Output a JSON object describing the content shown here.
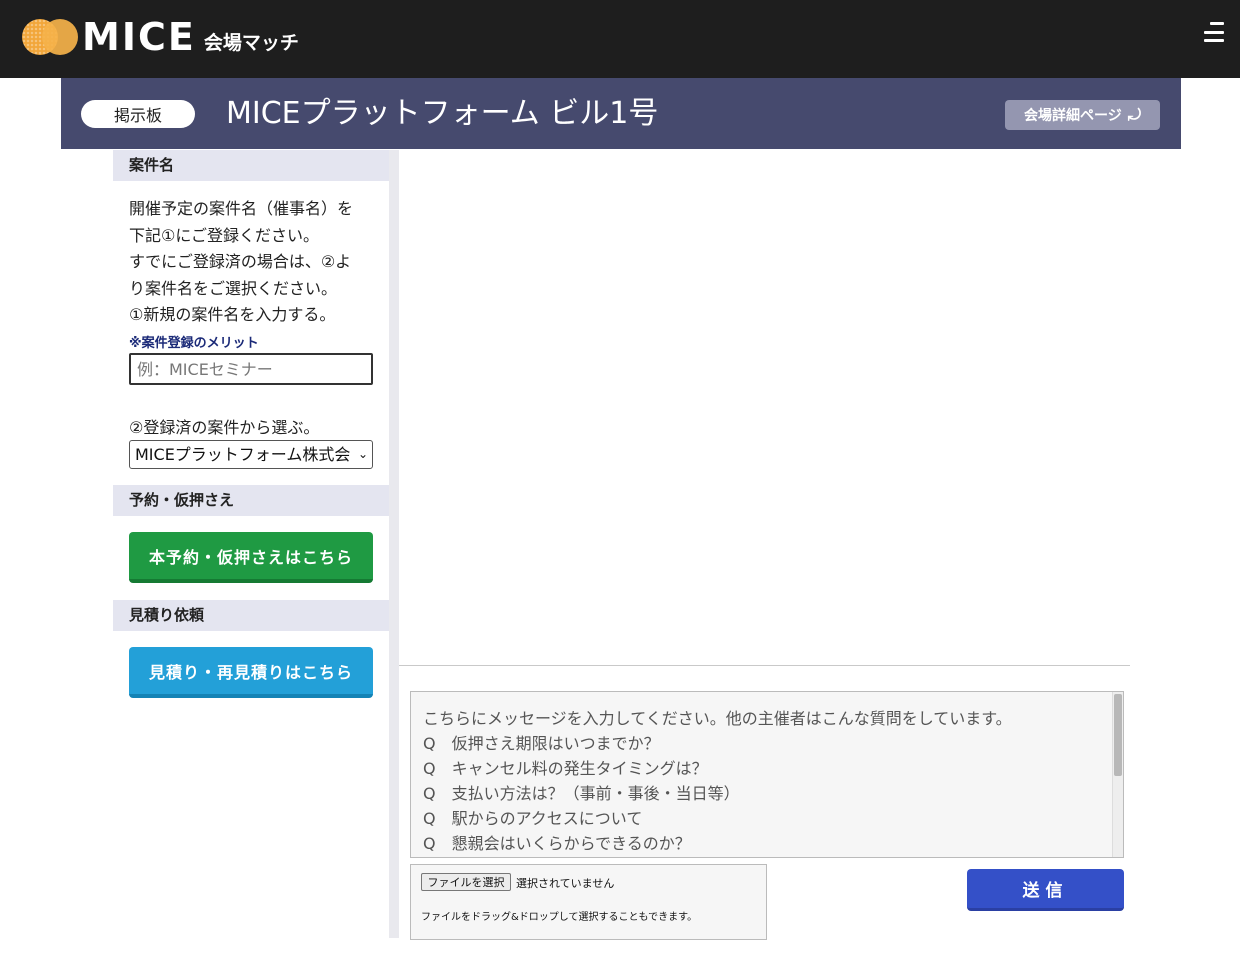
{
  "header": {
    "logo_text": "MICE",
    "logo_sub": "会場マッチ",
    "menu_icon": "hamburger-menu-icon"
  },
  "venue": {
    "board_label": "掲示板",
    "title": "MICEプラットフォーム ビル1号",
    "detail_button": "会場詳細ページ",
    "detail_icon": "return-arrow-icon",
    "bar_color": "#464a6e"
  },
  "sidebar": {
    "case_section": {
      "heading": "案件名",
      "description_lines": [
        "開催予定の案件名（催事名）を",
        "下記①にご登録ください。",
        "すでにご登録済の場合は、②よ",
        "り案件名をご選択ください。",
        "①新規の案件名を入力する。"
      ],
      "merit_link": "※案件登録のメリット",
      "input_placeholder": "例：MICEセミナー",
      "select_label": "②登録済の案件から選ぶ。",
      "select_value": "MICEプラットフォーム株式会"
    },
    "reservation_section": {
      "heading": "予約・仮押さえ",
      "button": "本予約・仮押さえはこちら",
      "button_color": "#1f9a43"
    },
    "estimate_section": {
      "heading": "見積り依頼",
      "button": "見積り・再見積りはこちら",
      "button_color": "#23a0d8"
    }
  },
  "composer": {
    "placeholder_lines": [
      "こちらにメッセージを入力してください。他の主催者はこんな質問をしています。",
      "Q　仮押さえ期限はいつまでか？",
      "Q　キャンセル料の発生タイミングは？",
      "Q　支払い方法は？（事前・事後・当日等）",
      "Q　駅からのアクセスについて",
      "Q　懇親会はいくらからできるのか？"
    ],
    "file_button": "ファイルを選択",
    "file_status": "選択されていません",
    "file_hint": "ファイルをドラッグ&ドロップして選択することもできます。",
    "send_button": "送信",
    "send_color": "#3450c8"
  }
}
